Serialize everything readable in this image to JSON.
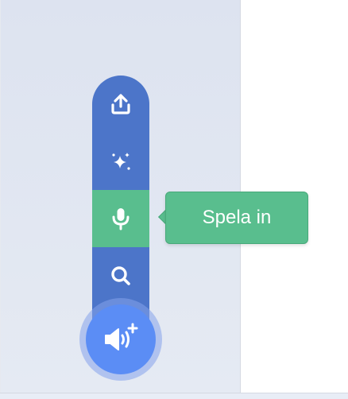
{
  "sound_menu": {
    "items": [
      {
        "name": "upload",
        "icon": "upload-icon",
        "color": "#4c75c9"
      },
      {
        "name": "surprise",
        "icon": "sparkles-icon",
        "color": "#4c75c9"
      },
      {
        "name": "record",
        "icon": "microphone-icon",
        "color": "#59be8e",
        "hovered": true
      },
      {
        "name": "search",
        "icon": "search-icon",
        "color": "#4c75c9"
      }
    ],
    "main_button_icon": "speaker-add-icon",
    "main_button_color": "#5b8df5"
  },
  "tooltip": {
    "label": "Spela in",
    "color": "#59be8e"
  }
}
